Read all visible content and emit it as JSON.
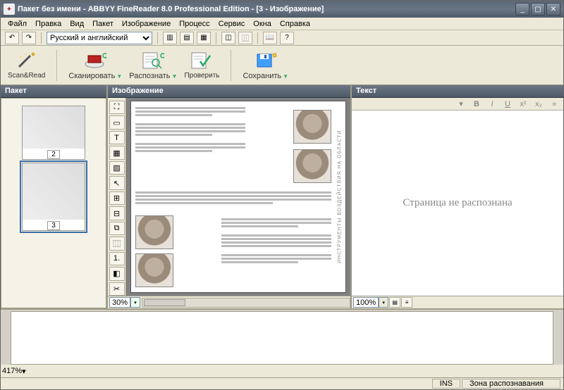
{
  "window": {
    "title": "Пакет без имени - ABBYY FineReader 8.0 Professional Edition - [3 - Изображение]"
  },
  "menu": {
    "file": "Файл",
    "edit": "Правка",
    "view": "Вид",
    "batch": "Пакет",
    "image": "Изображение",
    "process": "Процесс",
    "service": "Сервис",
    "windows": "Окна",
    "help": "Справка"
  },
  "language_select": "Русский и английский",
  "toolbar": {
    "scanread": "Scan&Read",
    "scan": "Сканировать",
    "recognize": "Распознать",
    "check": "Проверить",
    "save": "Сохранить"
  },
  "panels": {
    "package": "Пакет",
    "image": "Изображение",
    "text": "Текст"
  },
  "thumbs": [
    {
      "num": "2",
      "selected": false
    },
    {
      "num": "3",
      "selected": true
    }
  ],
  "zoom_image": "30%",
  "zoom_text": "100%",
  "zoom_bottom": "417%",
  "text_placeholder": "Страница не распознана",
  "page_sidecaption": "ИНСТРУМЕНТЫ ВОЗДЕЙСТВИЯ НА ОБЛАСТИ",
  "status": {
    "ins": "INS",
    "zone": "Зона распознавания"
  }
}
